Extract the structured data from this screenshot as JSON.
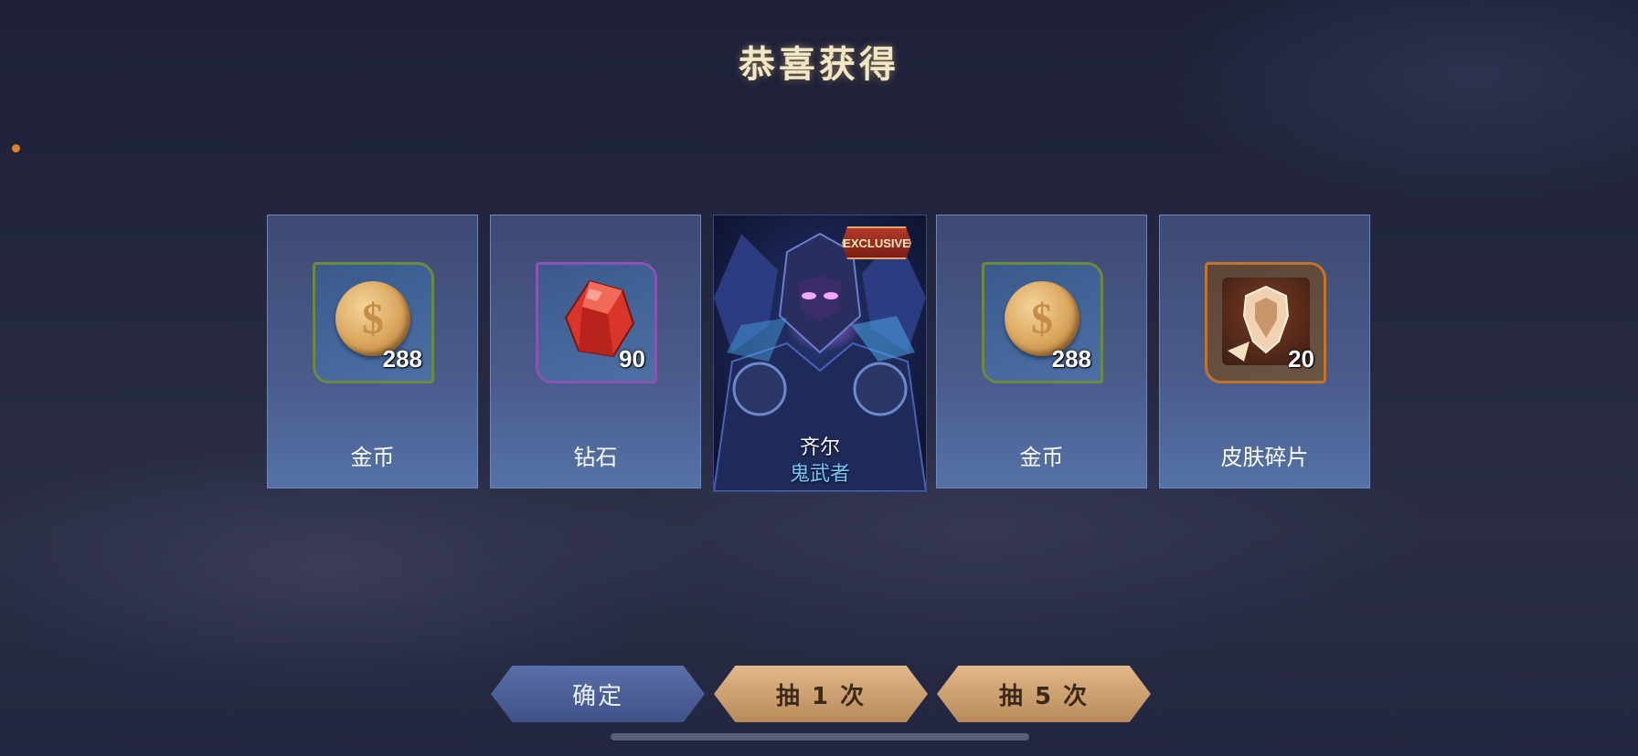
{
  "header": {
    "title": "恭喜获得"
  },
  "rewards": [
    {
      "name": "金币",
      "qty": "288",
      "icon": "gold-coin-icon",
      "rarity_color": "#6a8a3e"
    },
    {
      "name": "钻石",
      "qty": "90",
      "icon": "diamond-gem-icon",
      "rarity_color": "#8c52b0"
    },
    {
      "name": "齐尔",
      "subtitle": "鬼武者",
      "badge": "EXCLUSIVE",
      "icon": "hero-skin-portrait"
    },
    {
      "name": "金币",
      "qty": "288",
      "icon": "gold-coin-icon",
      "rarity_color": "#6a8a3e"
    },
    {
      "name": "皮肤碎片",
      "qty": "20",
      "icon": "skin-fragment-icon",
      "rarity_color": "#c4742a"
    }
  ],
  "buttons": {
    "confirm": "确定",
    "draw_once": "抽 1 次",
    "draw_five": "抽 5 次"
  },
  "colors": {
    "title": "#f3e6c4",
    "skin_name": "#72c6ff",
    "primary_button": "#3f5288",
    "draw_button": "#d4a876"
  }
}
